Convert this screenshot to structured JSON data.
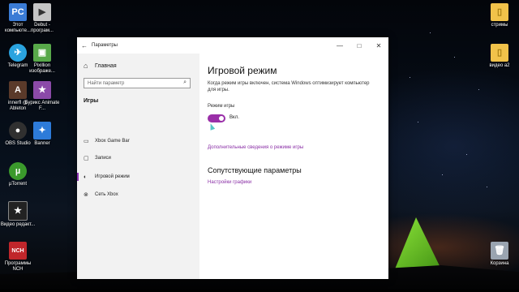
{
  "desktop": {
    "left_icons": [
      {
        "label": "Этот компьюте...",
        "glyph": "PC",
        "color": "#3a7bd5"
      },
      {
        "label": "Debut - програм...",
        "glyph": "▶",
        "color": "#c5c5c5"
      },
      {
        "label": "Telegram",
        "glyph": "✈",
        "color": "#2aa3df"
      },
      {
        "label": "Pixillion изображе...",
        "glyph": "▣",
        "color": "#58a94a"
      },
      {
        "label": "innerfl @ Ableton",
        "glyph": "A",
        "color": "#5a3a2a"
      },
      {
        "label": "Бурикс Animate F...",
        "glyph": "★",
        "color": "#8b4aa8"
      },
      {
        "label": "OBS Studio",
        "glyph": "●",
        "color": "#303030"
      },
      {
        "label": "Banner",
        "glyph": "✦",
        "color": "#2d7bd9"
      },
      {
        "label": "µTorrent",
        "glyph": "µ",
        "color": "#3b9a2c"
      },
      {
        "label": "Видео редакт...",
        "glyph": "★",
        "color": "#222222"
      },
      {
        "label": "Программы NCH",
        "glyph": "NCH",
        "color": "#c0262b"
      }
    ],
    "right_icons": [
      {
        "label": "стримы",
        "glyph": "▯",
        "color": "#f1c24a"
      },
      {
        "label": "видео a2",
        "glyph": "▯",
        "color": "#f1c24a"
      },
      {
        "label": "Корзина",
        "glyph": "🗑",
        "color": "#9aa4b0"
      }
    ]
  },
  "window": {
    "title": "Параметры",
    "back_icon": "←",
    "minimize": "—",
    "maximize": "□",
    "close": "✕"
  },
  "sidebar": {
    "home_label": "Главная",
    "search_placeholder": "Найти параметр",
    "section": "Игры",
    "items": [
      {
        "label": "Xbox Game Bar",
        "icon": "game-bar-icon",
        "glyph": "▭"
      },
      {
        "label": "Записи",
        "icon": "captures-icon",
        "glyph": "▢"
      },
      {
        "label": "Игровой режим",
        "icon": "game-mode-icon",
        "glyph": "◐",
        "active": true
      },
      {
        "label": "Сеть Xbox",
        "icon": "xbox-icon",
        "glyph": "⊗"
      }
    ]
  },
  "content": {
    "title": "Игровой режим",
    "description": "Когда режим игры включен, система Windows оптимизирует компьютер для игры.",
    "toggle_label": "Режим игры",
    "toggle_state": "Вкл.",
    "toggle_on": true,
    "more_link": "Дополнительные сведения о режиме игры",
    "related_title": "Сопутствующие параметры",
    "related_link": "Настройки графики"
  },
  "colors": {
    "accent": "#9a2fa8",
    "link": "#8a2fa6"
  }
}
